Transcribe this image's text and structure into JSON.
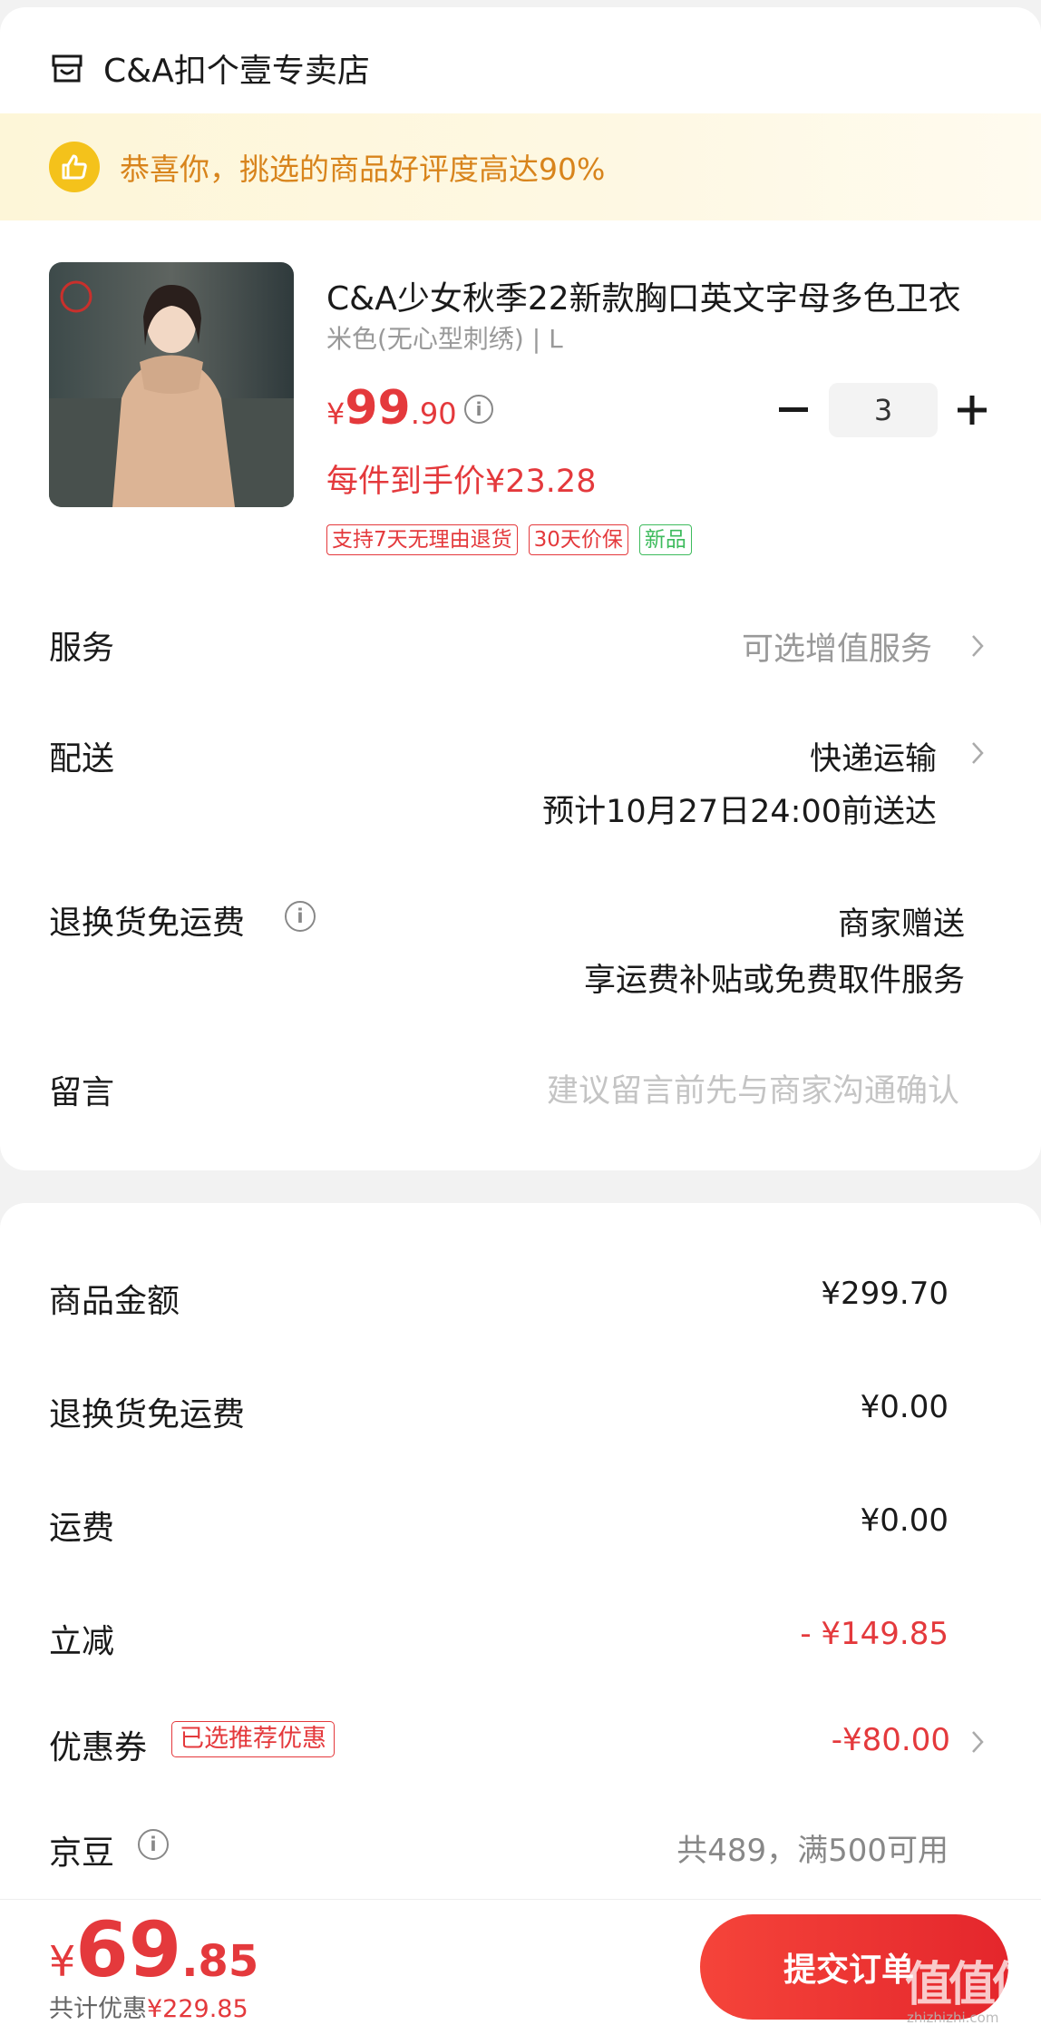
{
  "shop": {
    "name": "C&A扣个壹专卖店",
    "icon": "shop-icon"
  },
  "banner": {
    "text": "恭喜你，挑选的商品好评度高达90%",
    "icon": "thumbs-up-icon"
  },
  "product": {
    "title": "C&A少女秋季22新款胸口英文字母多色卫衣",
    "spec": "米色(无心型刺绣) | L",
    "price_currency": "¥",
    "price_int": "99",
    "price_dec": ".90",
    "quantity": "3",
    "unit_price": "每件到手价¥23.28",
    "tags": [
      "支持7天无理由退货",
      "30天价保",
      "新品"
    ]
  },
  "rows": {
    "service_label": "服务",
    "service_value": "可选增值服务",
    "delivery_label": "配送",
    "delivery_value": "快递运输",
    "delivery_eta": "预计10月27日24:00前送达",
    "return_label": "退换货免运费",
    "return_value": "商家赠送",
    "return_sub": "享运费补贴或免费取件服务",
    "note_label": "留言",
    "note_placeholder": "建议留言前先与商家沟通确认"
  },
  "summary": {
    "goods_label": "商品金额",
    "goods_value": "¥299.70",
    "return_fee_label": "退换货免运费",
    "return_fee_value": "¥0.00",
    "shipping_label": "运费",
    "shipping_value": "¥0.00",
    "discount_label": "立减",
    "discount_value": "- ¥149.85",
    "coupon_label": "优惠券",
    "coupon_tag": "已选推荐优惠",
    "coupon_value": "-¥80.00",
    "jd_bean_label": "京豆",
    "jd_bean_value": "共489，满500可用"
  },
  "footer": {
    "total_currency": "¥",
    "total_int": "69",
    "total_dec": ".85",
    "saving_label": "共计优惠",
    "saving_value": "¥229.85",
    "submit_label": "提交订单",
    "watermark": "值值值",
    "watermark_sub": "zhizhizhi.com"
  },
  "colors": {
    "accent_red": "#e4393c",
    "banner_text": "#d8841c",
    "tag_green": "#3dbb5c"
  }
}
